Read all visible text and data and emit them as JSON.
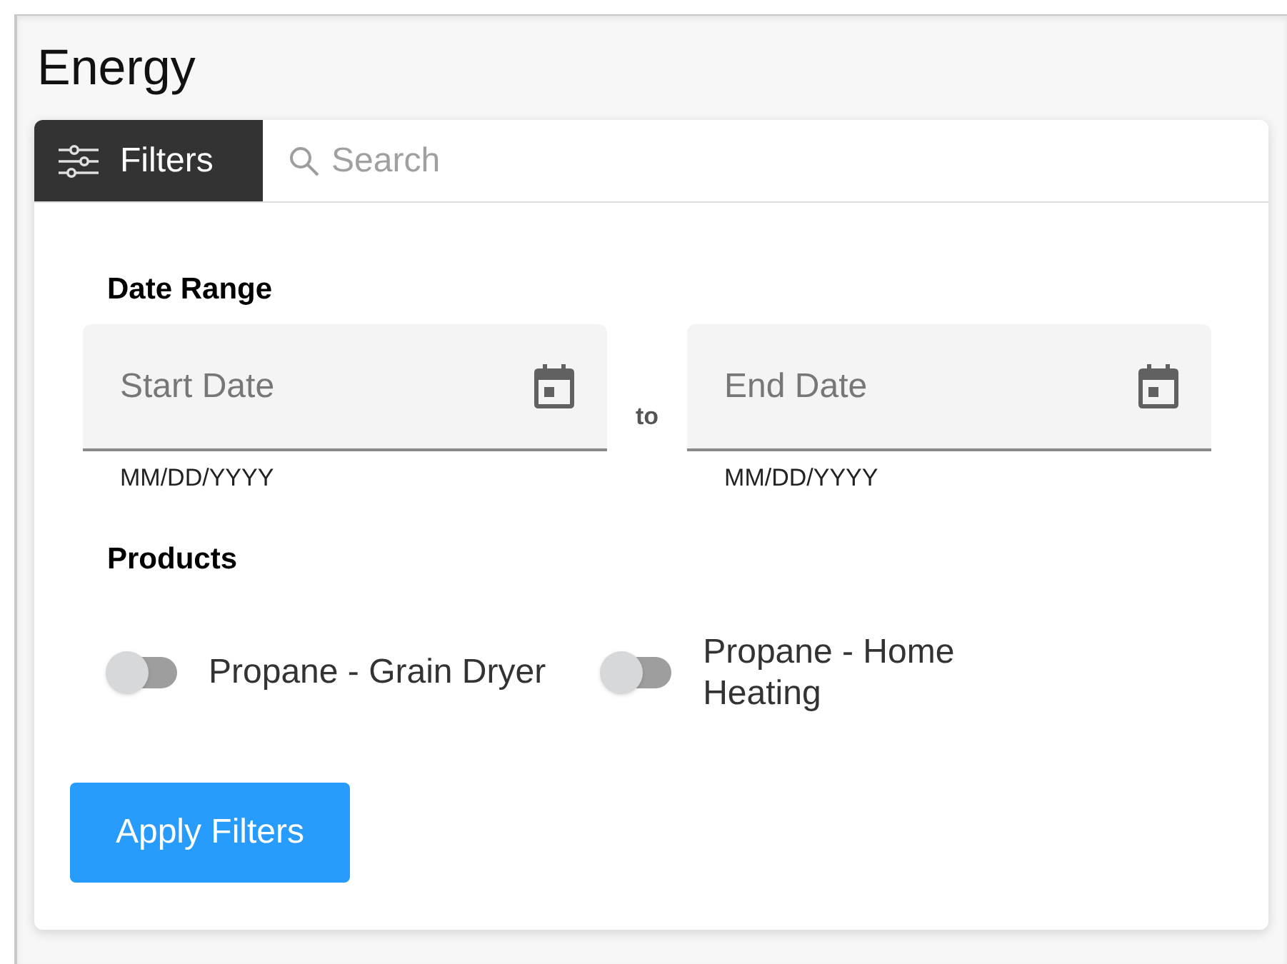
{
  "page": {
    "title": "Energy"
  },
  "toolbar": {
    "filters_tab": {
      "label": "Filters",
      "selected": true
    },
    "search": {
      "placeholder": "Search"
    }
  },
  "date_range": {
    "label": "Date Range",
    "separator": "to",
    "fields": [
      {
        "placeholder": "Start Date",
        "helper": "MM/DD/YYYY"
      },
      {
        "placeholder": "End Date",
        "helper": "MM/DD/YYYY"
      }
    ]
  },
  "products": {
    "label": "Products",
    "items": [
      {
        "label": "Propane - Grain Dryer",
        "on": false
      },
      {
        "label": "Propane - Home Heating",
        "on": false
      }
    ]
  },
  "apply_button": {
    "label": "Apply Filters"
  }
}
